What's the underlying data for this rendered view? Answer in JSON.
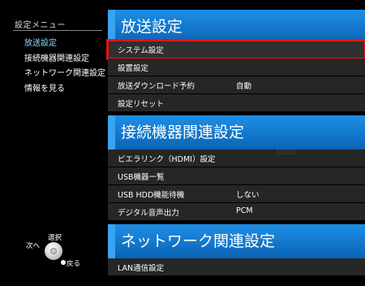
{
  "menu": {
    "title": "設定メニュー",
    "items": [
      {
        "label": "放送設定"
      },
      {
        "label": "接続機器関連設定"
      },
      {
        "label": "ネットワーク関連設定"
      },
      {
        "label": "情報を見る"
      }
    ]
  },
  "hint": {
    "select": "選択",
    "next": "次へ",
    "back": "戻る"
  },
  "sections": [
    {
      "title": "放送設定",
      "rows": [
        {
          "label": "システム設定",
          "value": ""
        },
        {
          "label": "設置設定",
          "value": ""
        },
        {
          "label": "放送ダウンロード予約",
          "value": "自動"
        },
        {
          "label": "設定リセット",
          "value": ""
        }
      ]
    },
    {
      "title": "接続機器関連設定",
      "rows": [
        {
          "label": "ビエラリンク（HDMI）設定",
          "value": ""
        },
        {
          "label": "USB機器一覧",
          "value": ""
        },
        {
          "label": "USB HDD機能待機",
          "value": "しない"
        },
        {
          "label": "デジタル音声出力",
          "value": "PCM"
        }
      ]
    },
    {
      "title": "ネットワーク関連設定",
      "rows": [
        {
          "label": "LAN通信設定",
          "value": ""
        }
      ]
    }
  ],
  "ghost_text": "12031",
  "colors": {
    "section_header": "#1478d4",
    "selection_outline": "#e11111",
    "active_menu": "#8fd6ff"
  }
}
